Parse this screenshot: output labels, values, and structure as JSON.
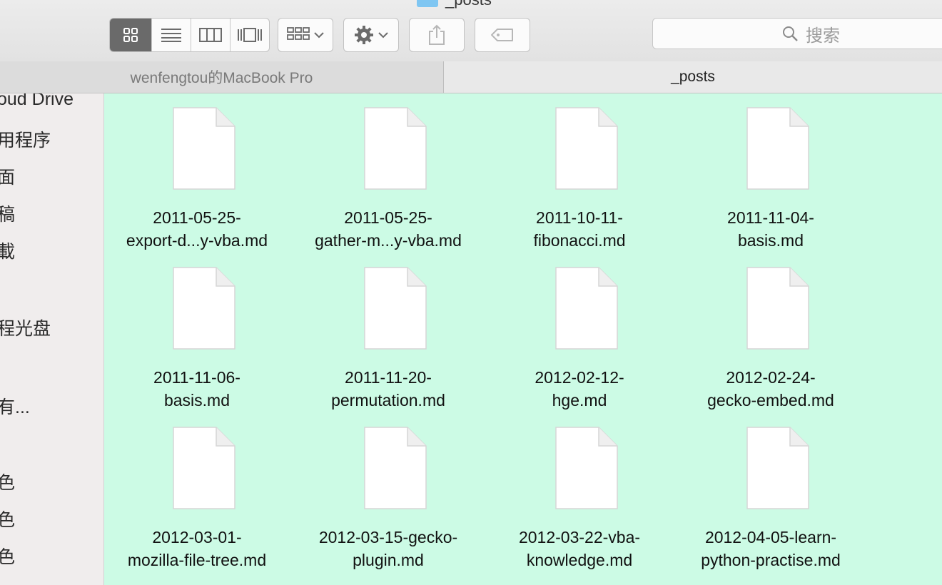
{
  "window": {
    "title": "_posts"
  },
  "toolbar": {
    "view_icon": "icon-view-icon",
    "view_list": "list-view-icon",
    "view_columns": "column-view-icon",
    "view_coverflow": "coverflow-view-icon",
    "arrange": "arrange-grid-icon",
    "action": "gear-icon",
    "share": "share-icon",
    "tags": "tag-icon",
    "search_placeholder": "搜索"
  },
  "pathbar": {
    "left_tab": "wenfengtou的MacBook Pro",
    "right_tab": "_posts"
  },
  "sidebar": {
    "items": [
      "oud Drive",
      "用程序",
      "面",
      "稿",
      "載",
      "程光盘",
      "有...",
      "色",
      "色",
      "色"
    ]
  },
  "files": [
    {
      "line1": "2011-05-25-",
      "line2": "export-d...y-vba.md"
    },
    {
      "line1": "2011-05-25-",
      "line2": "gather-m...y-vba.md"
    },
    {
      "line1": "2011-10-11-",
      "line2": "fibonacci.md"
    },
    {
      "line1": "2011-11-04-",
      "line2": "basis.md"
    },
    {
      "line1": "2011-11-06-",
      "line2": "basis.md"
    },
    {
      "line1": "2011-11-20-",
      "line2": "permutation.md"
    },
    {
      "line1": "2012-02-12-",
      "line2": "hge.md"
    },
    {
      "line1": "2012-02-24-",
      "line2": "gecko-embed.md"
    },
    {
      "line1": "2012-03-01-",
      "line2": "mozilla-file-tree.md"
    },
    {
      "line1": "2012-03-15-gecko-",
      "line2": "plugin.md"
    },
    {
      "line1": "2012-03-22-vba-",
      "line2": "knowledge.md"
    },
    {
      "line1": "2012-04-05-learn-",
      "line2": "python-practise.md"
    }
  ],
  "colors": {
    "content_background": "#ccfbe5",
    "active_view_button": "#6a6a6a",
    "folder_icon": "#7fc6f2"
  }
}
